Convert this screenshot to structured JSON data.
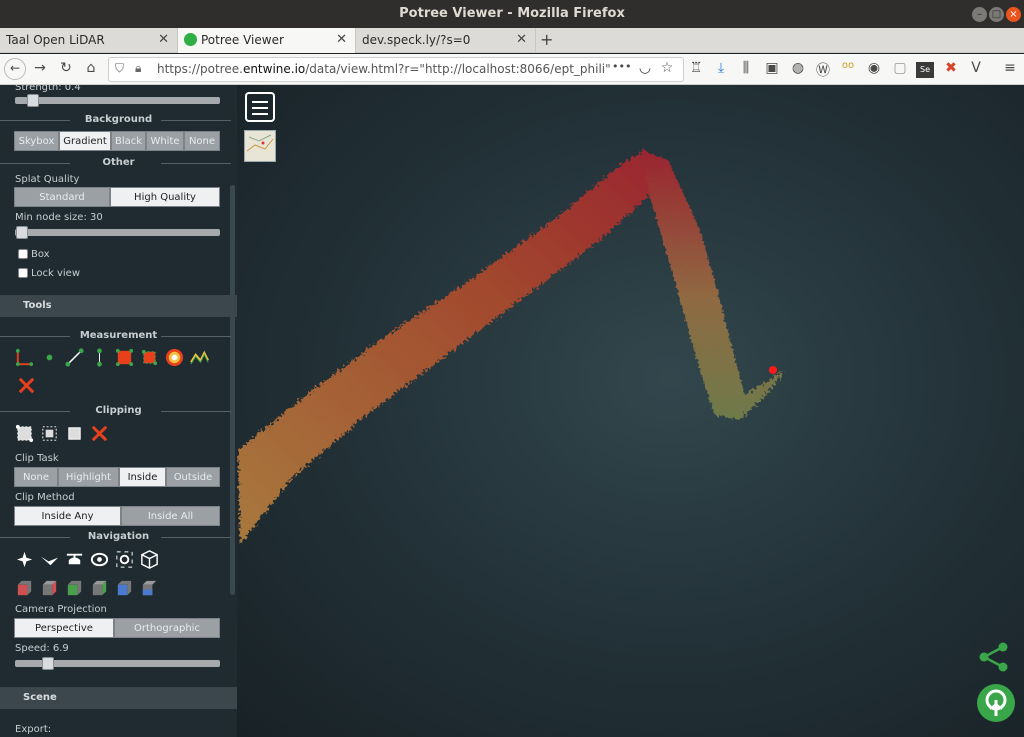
{
  "window": {
    "title": "Potree Viewer - Mozilla Firefox"
  },
  "tabs": [
    {
      "label": "Taal Open LiDAR",
      "active": false
    },
    {
      "label": "Potree Viewer",
      "active": true
    },
    {
      "label": "dev.speck.ly/?s=0",
      "active": false
    }
  ],
  "nav": {
    "url_prefix": "https://potree.",
    "url_domain": "entwine.io",
    "url_rest": "/data/view.html?r=\"http://localhost:8066/ept_phili\"",
    "more": "•••"
  },
  "sidebar": {
    "strength_label": "Strength: 0.4",
    "strength_value": 0.4,
    "background": {
      "title": "Background",
      "options": [
        "Skybox",
        "Gradient",
        "Black",
        "White",
        "None"
      ],
      "selected": "Gradient"
    },
    "other": {
      "title": "Other",
      "splat_quality_label": "Splat Quality",
      "splat_options": [
        "Standard",
        "High Quality"
      ],
      "splat_selected": "High Quality",
      "min_node_label": "Min node size: 30",
      "box_label": "Box",
      "lock_label": "Lock view"
    },
    "tools_title": "Tools",
    "measurement_title": "Measurement",
    "clipping": {
      "title": "Clipping",
      "clip_task_label": "Clip Task",
      "task_options": [
        "None",
        "Highlight",
        "Inside",
        "Outside"
      ],
      "task_selected": "Inside",
      "clip_method_label": "Clip Method",
      "method_options": [
        "Inside Any",
        "Inside All"
      ],
      "method_selected": "Inside Any"
    },
    "navigation": {
      "title": "Navigation",
      "camera_projection_label": "Camera Projection",
      "projection_options": [
        "Perspective",
        "Orthographic"
      ],
      "projection_selected": "Perspective",
      "speed_label": "Speed: 6.9"
    },
    "scene_title": "Scene",
    "export_label": "Export:"
  },
  "colors": {
    "accent_green": "#3aa64a",
    "measure_red": "#e8401c",
    "sidebar_bg": "#1f2b31"
  }
}
